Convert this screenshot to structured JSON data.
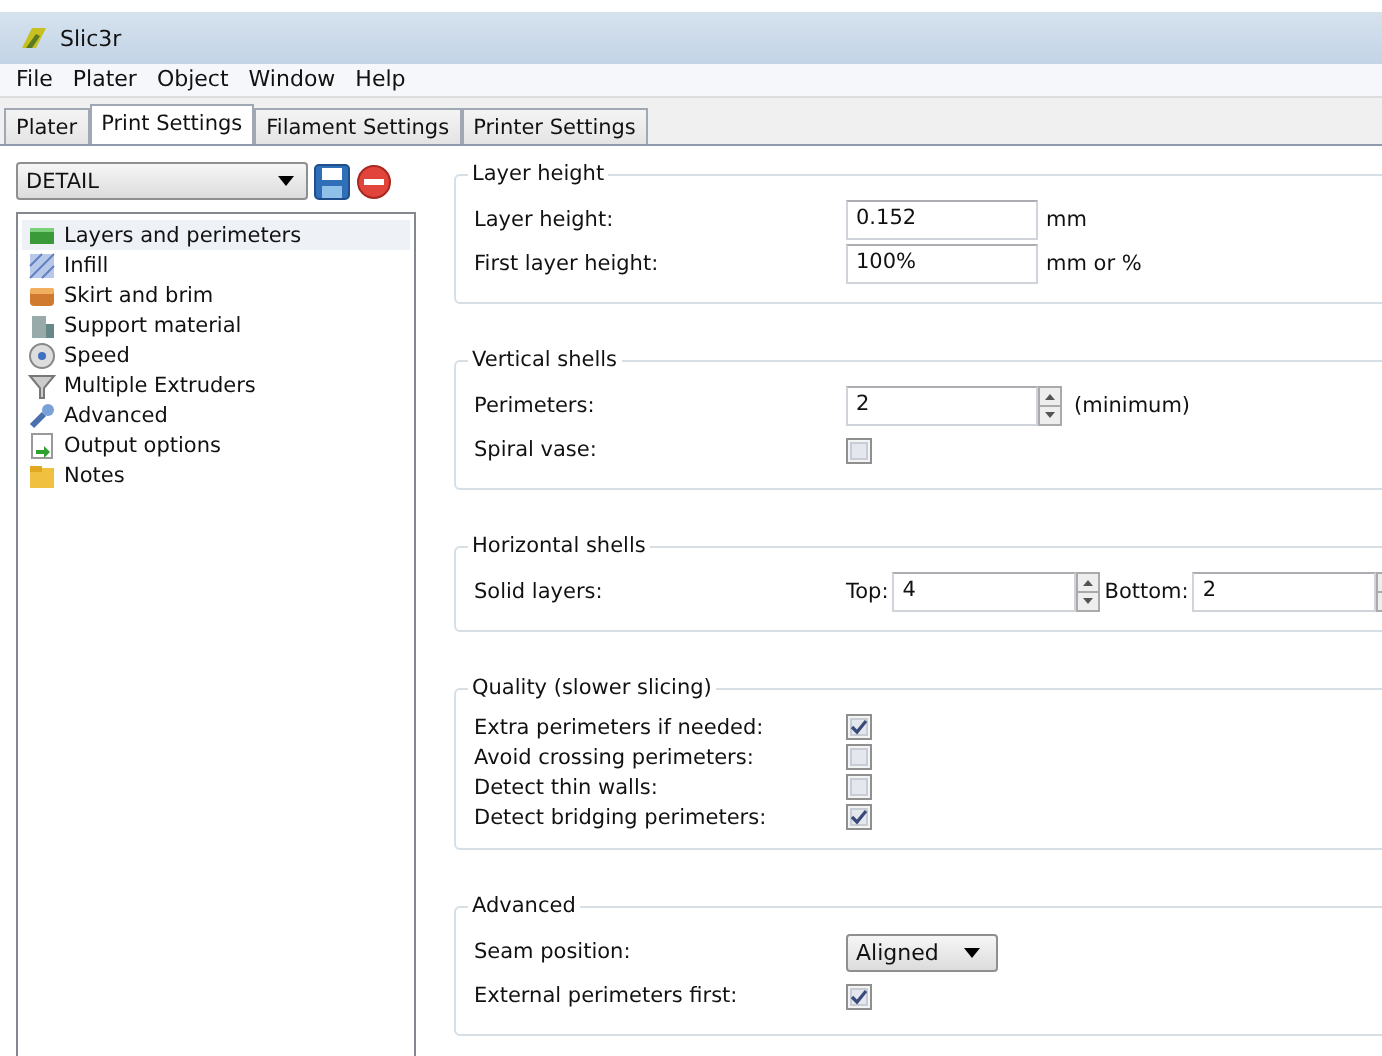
{
  "window": {
    "title": "Slic3r"
  },
  "menu": [
    "File",
    "Plater",
    "Object",
    "Window",
    "Help"
  ],
  "tabs": [
    {
      "label": "Plater",
      "selected": false
    },
    {
      "label": "Print Settings",
      "selected": true
    },
    {
      "label": "Filament Settings",
      "selected": false
    },
    {
      "label": "Printer Settings",
      "selected": false
    }
  ],
  "preset": {
    "value": "DETAIL"
  },
  "sidebar": {
    "items": [
      {
        "label": "Layers and perimeters",
        "selected": true
      },
      {
        "label": "Infill",
        "selected": false
      },
      {
        "label": "Skirt and brim",
        "selected": false
      },
      {
        "label": "Support material",
        "selected": false
      },
      {
        "label": "Speed",
        "selected": false
      },
      {
        "label": "Multiple Extruders",
        "selected": false
      },
      {
        "label": "Advanced",
        "selected": false
      },
      {
        "label": "Output options",
        "selected": false
      },
      {
        "label": "Notes",
        "selected": false
      }
    ]
  },
  "sections": [
    {
      "title": "Layer height",
      "compact": false,
      "rows": [
        {
          "kind": "text",
          "label": "Layer height:",
          "value": "0.152",
          "unit": "mm"
        },
        {
          "kind": "text",
          "label": "First layer height:",
          "value": "100%",
          "unit": "mm or %"
        }
      ]
    },
    {
      "title": "Vertical shells",
      "compact": false,
      "rows": [
        {
          "kind": "spin",
          "label": "Perimeters:",
          "value": "2",
          "unit": "(minimum)"
        },
        {
          "kind": "checkbox",
          "label": "Spiral vase:",
          "checked": false
        }
      ]
    },
    {
      "title": "Horizontal shells",
      "compact": false,
      "rows": [
        {
          "kind": "spin_pair",
          "label": "Solid layers:",
          "fields": [
            {
              "prefix": "Top:",
              "value": "4"
            },
            {
              "prefix": "Bottom:",
              "value": "2"
            }
          ]
        }
      ]
    },
    {
      "title": "Quality (slower slicing)",
      "compact": true,
      "rows": [
        {
          "kind": "checkbox",
          "label": "Extra perimeters if needed:",
          "checked": true
        },
        {
          "kind": "checkbox",
          "label": "Avoid crossing perimeters:",
          "checked": false
        },
        {
          "kind": "checkbox",
          "label": "Detect thin walls:",
          "checked": false
        },
        {
          "kind": "checkbox",
          "label": "Detect bridging perimeters:",
          "checked": true
        }
      ]
    },
    {
      "title": "Advanced",
      "compact": false,
      "rows": [
        {
          "kind": "select",
          "label": "Seam position:",
          "value": "Aligned"
        },
        {
          "kind": "checkbox",
          "label": "External perimeters first:",
          "checked": true
        }
      ]
    }
  ]
}
